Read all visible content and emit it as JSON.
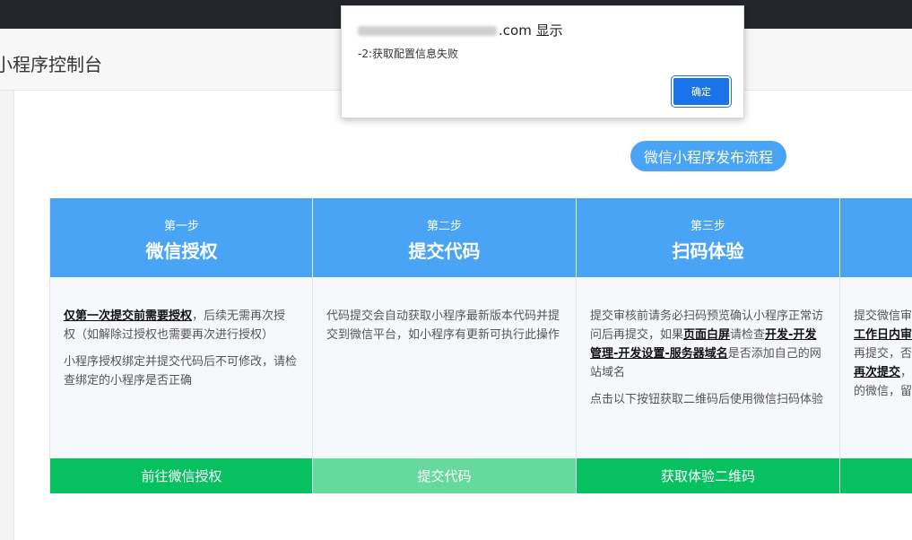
{
  "header": {
    "title": "小程序控制台"
  },
  "flow_button": {
    "label": "微信小程序发布流程"
  },
  "steps": [
    {
      "sub": "第一步",
      "title": "微信授权",
      "p1_bold": "仅第一次提交前需要授权",
      "p1_rest": "，后续无需再次授权（如解除过授权也需要再次进行授权）",
      "p2": "小程序授权绑定并提交代码后不可修改，请检查绑定的小程序是否正确",
      "action": "前往微信授权",
      "action_color": "#07c160"
    },
    {
      "sub": "第二步",
      "title": "提交代码",
      "p1": "代码提交会自动获取小程序最新版本代码并提交到微信平台，如小程序有更新可执行此操作",
      "action": "提交代码",
      "action_color": "#66d99c"
    },
    {
      "sub": "第三步",
      "title": "扫码体验",
      "p1_pre": "提交审核前请务必扫码预览确认小程序正常访问后再提交，如果",
      "p1_b1": "页面白屏",
      "p1_mid": "请检查",
      "p1_b2": "开发-开发管理-开发设置-服务器域名",
      "p1_post": "是否添加自己的网站域名",
      "p2": "点击以下按钮获取二维码后使用微信扫码体验",
      "action": "获取体验二维码",
      "action_color": "#07c160"
    },
    {
      "l1": "提交微信审核",
      "l2_b": "工作日内审核",
      "l3": "再提交，否",
      "l4_b": "再次提交",
      "l4_rest": "，",
      "l5": "的微信，留",
      "action_color": "#07c160"
    }
  ],
  "dialog": {
    "title_suffix": ".com 显示",
    "message": "-2:获取配置信息失败",
    "ok_label": "确定"
  }
}
